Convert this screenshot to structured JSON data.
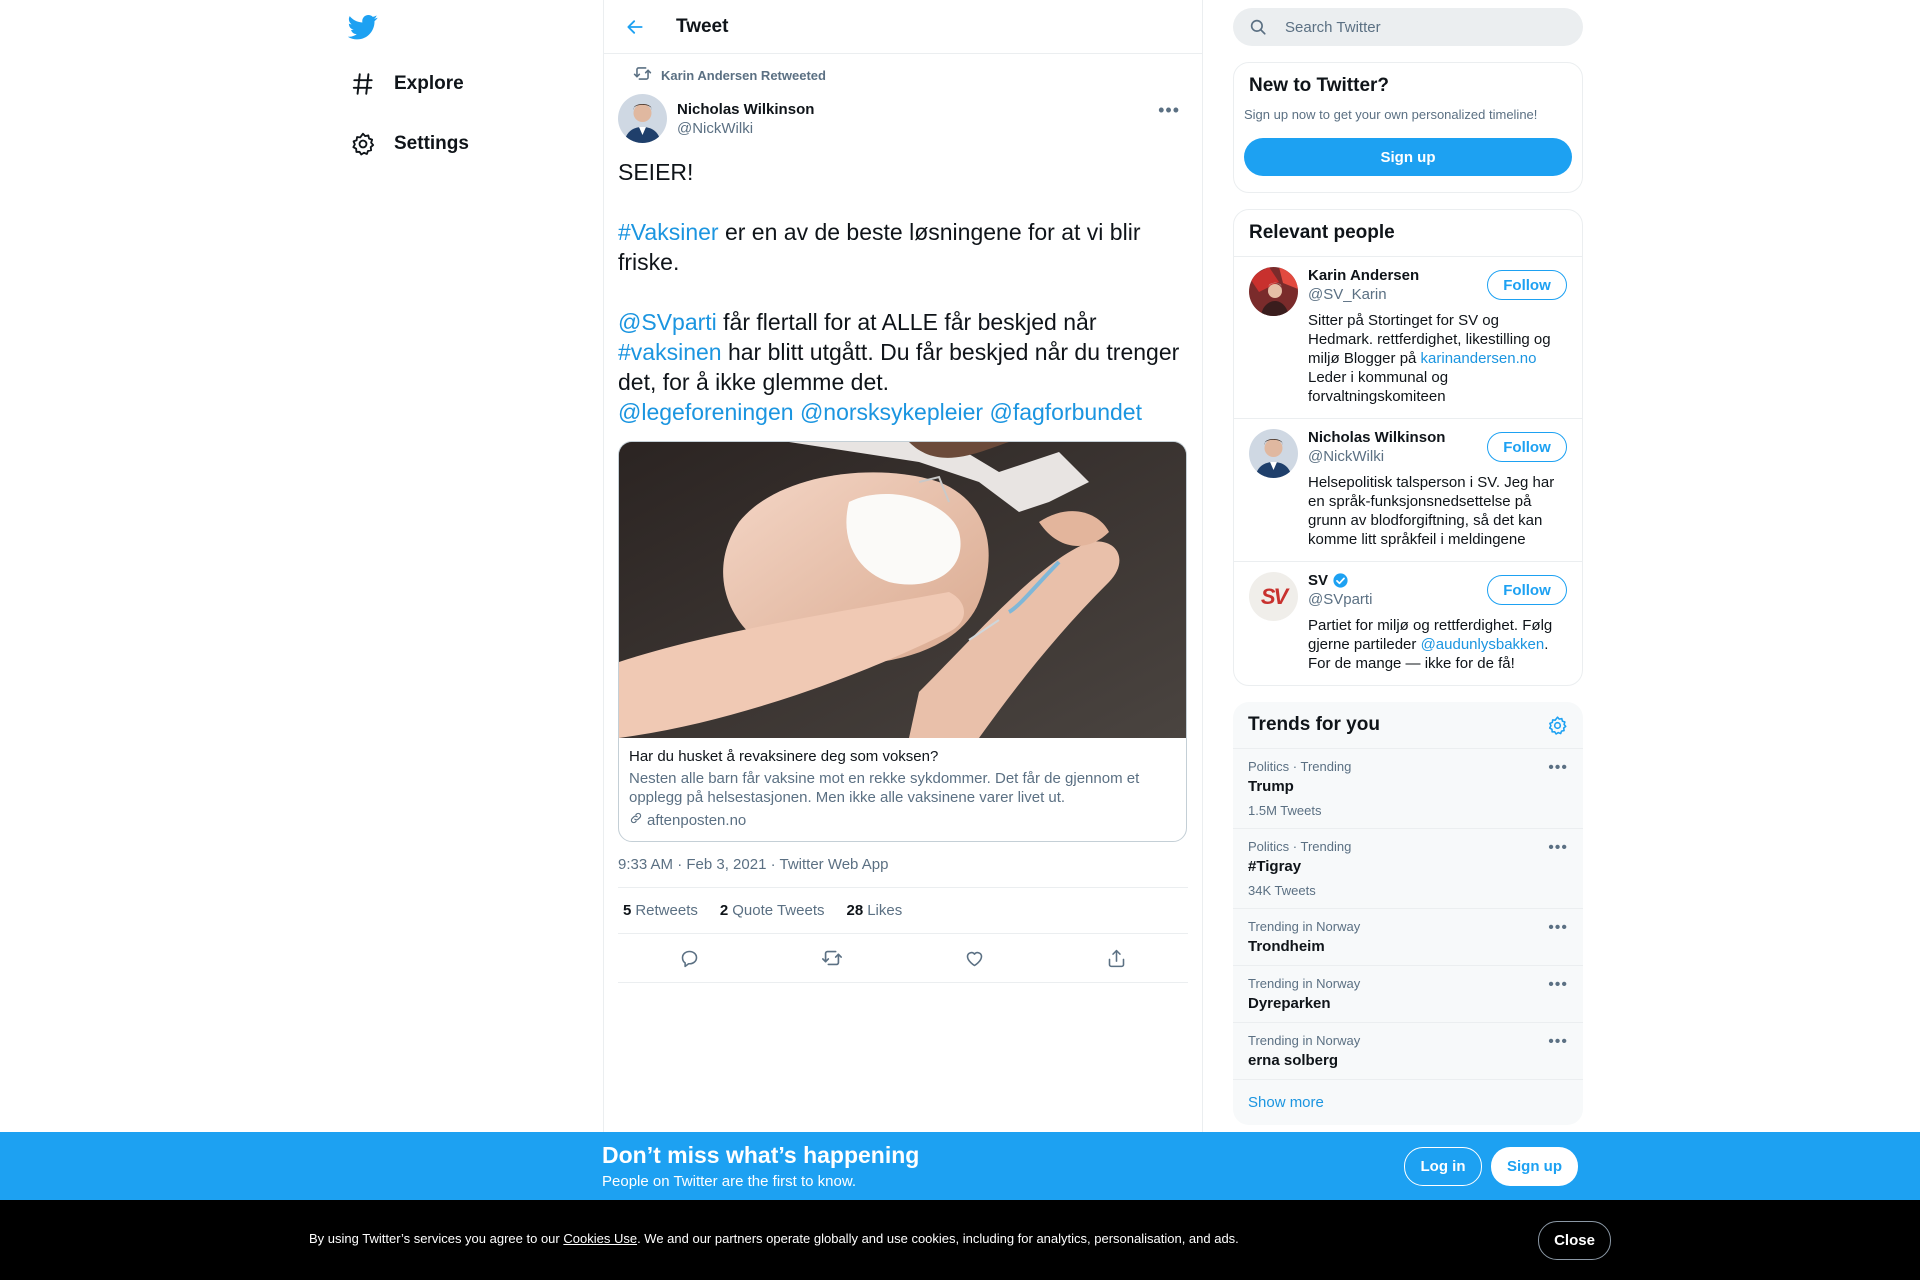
{
  "nav": {
    "items": [
      {
        "label": "Explore",
        "icon": "hash-icon"
      },
      {
        "label": "Settings",
        "icon": "gear-icon"
      }
    ]
  },
  "header": {
    "title": "Tweet"
  },
  "tweet": {
    "retweeted_by": "Karin Andersen Retweeted",
    "author_name": "Nicholas Wilkinson",
    "author_handle": "@NickWilki",
    "line1": "SEIER!",
    "p2_tag": "#Vaksiner",
    "p2_text": " er en av de beste løsningene for at vi blir friske.",
    "p3_mention": "@SVparti",
    "p3_text1": " får flertall for at ALLE får beskjed når ",
    "p3_tag": "#vaksinen",
    "p3_text2": " har blitt utgått. Du får beskjed når du trenger det, for å ikke glemme det.",
    "mentions": [
      "@legeforeningen",
      "@norsksykepleier",
      "@fagforbundet"
    ],
    "card": {
      "title": "Har du husket å revaksinere deg som voksen?",
      "description": "Nesten alle barn får vaksine mot en rekke sykdommer. Det får de gjennom et opplegg på helsestasjonen. Men ikke alle vaksinene varer livet ut.",
      "domain": "aftenposten.no"
    },
    "meta": "9:33 AM · Feb 3, 2021 · Twitter Web App",
    "stats": {
      "retweets_count": "5",
      "retweets_label": "Retweets",
      "quotes_count": "2",
      "quotes_label": "Quote Tweets",
      "likes_count": "28",
      "likes_label": "Likes"
    }
  },
  "search": {
    "placeholder": "Search Twitter"
  },
  "new_to_twitter": {
    "title": "New to Twitter?",
    "subtitle": "Sign up now to get your own personalized timeline!",
    "button": "Sign up"
  },
  "relevant": {
    "title": "Relevant people",
    "follow_label": "Follow",
    "people": [
      {
        "name": "Karin Andersen",
        "handle": "@SV_Karin",
        "bio_before": "Sitter på Stortinget for SV og Hedmark. rettferdighet, likestilling og miljø Blogger på ",
        "bio_link": "karinandersen.no",
        "bio_after": " Leder i kommunal og forvaltningskomiteen"
      },
      {
        "name": "Nicholas Wilkinson",
        "handle": "@NickWilki",
        "bio": "Helsepolitisk talsperson i SV. Jeg har en språk-funksjonsnedsettelse på grunn av blodforgiftning, så det kan komme litt språkfeil i meldingene"
      },
      {
        "name": "SV",
        "handle": "@SVparti",
        "avatar_text": "SV",
        "bio_before": "Partiet for miljø og rettferdighet. Følg gjerne partileder ",
        "bio_link": "@audunlysbakken",
        "bio_after": ". For de mange — ikke for de få!"
      }
    ]
  },
  "trends": {
    "title": "Trends for you",
    "items": [
      {
        "context": "Politics · Trending",
        "name": "Trump",
        "count": "1.5M Tweets"
      },
      {
        "context": "Politics · Trending",
        "name": "#Tigray",
        "count": "34K Tweets"
      },
      {
        "context": "Trending in Norway",
        "name": "Trondheim"
      },
      {
        "context": "Trending in Norway",
        "name": "Dyreparken"
      },
      {
        "context": "Trending in Norway",
        "name": "erna solberg"
      }
    ],
    "show_more": "Show more"
  },
  "banner": {
    "title": "Don’t miss what’s happening",
    "subtitle": "People on Twitter are the first to know.",
    "login": "Log in",
    "signup": "Sign up"
  },
  "cookie": {
    "before": "By using Twitter’s services you agree to our ",
    "link": "Cookies Use",
    "after": ". We and our partners operate globally and use cookies, including for analytics, personalisation, and ads.",
    "close": "Close"
  },
  "colors": {
    "accent": "#1da1f2",
    "link": "#1b95e0",
    "muted": "#5b7083",
    "border": "#ebeef0"
  }
}
